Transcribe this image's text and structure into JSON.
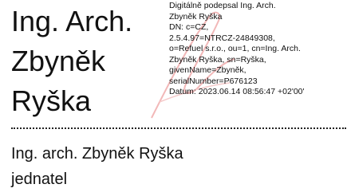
{
  "signature": {
    "name_lines": [
      "Ing. Arch.",
      "Zbyněk",
      "Ryška"
    ],
    "details": [
      "Digitálně podepsal Ing. Arch.",
      "Zbyněk Ryška",
      "DN: c=CZ,",
      "2.5.4.97=NTRCZ-24849308,",
      "o=Refuel s.r.o., ou=1, cn=Ing. Arch.",
      "Zbyněk Ryška, sn=Ryška,",
      "givenName=Zbyněk,",
      "serialNumber=P676123",
      "Datum: 2023.06.14 08:56:47 +02'00'"
    ],
    "watermark_color": "#f2b8b8"
  },
  "signatory": {
    "name": "Ing. arch. Zbyněk Ryška",
    "role": "jednatel"
  }
}
